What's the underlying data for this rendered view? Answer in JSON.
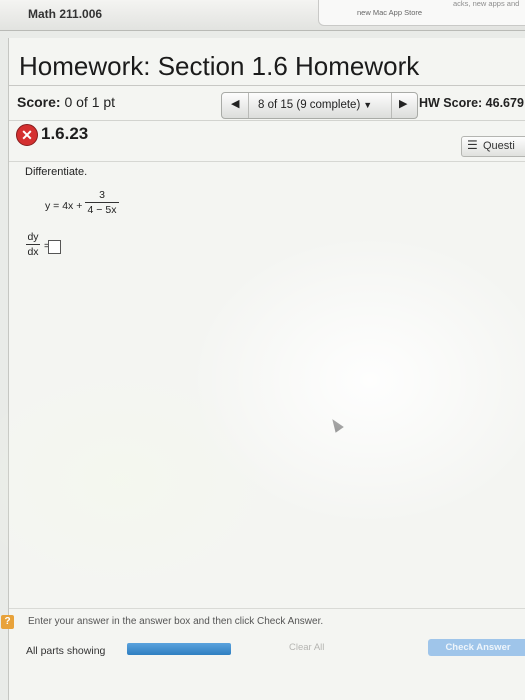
{
  "header": {
    "course": "Math 211.006",
    "notification": {
      "line1": "acks, new apps and",
      "line2": "new Mac App Store"
    }
  },
  "assignment": {
    "title": "Homework: Section 1.6 Homework",
    "score_label": "Score:",
    "score_value": "0 of 1 pt",
    "navigation": {
      "prev_icon": "◀",
      "progress": "8 of 15 (9 complete)",
      "dropdown_icon": "▼",
      "next_icon": "▶"
    },
    "hw_score_label": "HW Score: 46.67",
    "hw_score_value": "9"
  },
  "question": {
    "status_icon": "x-mark-icon",
    "status_glyph": "✕",
    "id": "1.6.23",
    "menu_icon": "☰",
    "menu_label": "Questi",
    "instruction": "Differentiate.",
    "equation": {
      "lhs": "y = 4x +",
      "numerator": "3",
      "denominator": "4 − 5x"
    },
    "derivative": {
      "numerator": "dy",
      "denominator": "dx",
      "equals": "="
    }
  },
  "footer": {
    "help_glyph": "?",
    "hint": "Enter your answer in the answer box and then click Check Answer.",
    "parts_label": "All parts showing",
    "clear_all": "Clear All",
    "check_answer": "Check Answer"
  },
  "colors": {
    "error": "#d43030",
    "progress_bar": "#2f7fc1",
    "check_button": "#9fc5ea",
    "help": "#e8a23a"
  }
}
